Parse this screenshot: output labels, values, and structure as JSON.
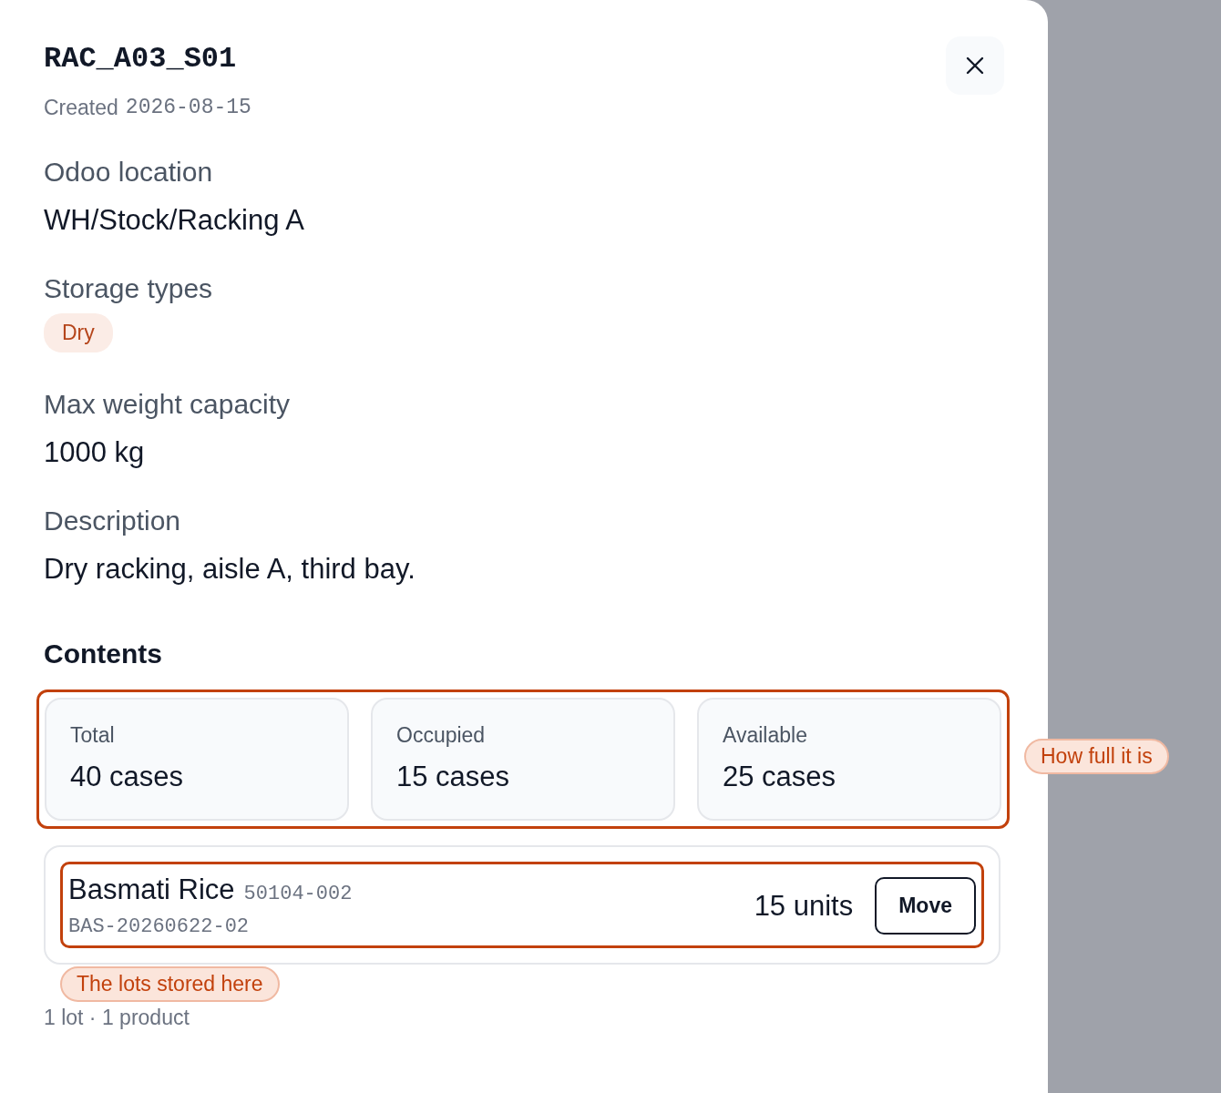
{
  "title": "RAC_A03_S01",
  "created_label": "Created",
  "created_date": "2026-08-15",
  "fields": [
    {
      "label": "Odoo location",
      "kind": "text",
      "value": "WH/Stock/Racking A"
    },
    {
      "label": "Storage types",
      "kind": "tags",
      "tags": [
        "Dry"
      ]
    },
    {
      "label": "Max weight capacity",
      "kind": "text",
      "value": "1000 kg"
    },
    {
      "label": "Description",
      "kind": "text",
      "value": "Dry racking, aisle A, third bay."
    }
  ],
  "contents": {
    "heading": "Contents",
    "stats": [
      {
        "label": "Total",
        "value": "40 cases"
      },
      {
        "label": "Occupied",
        "value": "15 cases"
      },
      {
        "label": "Available",
        "value": "25 cases"
      }
    ],
    "stats_callout": "How full it is",
    "lots": [
      {
        "name": "Basmati Rice",
        "code": "50104-002",
        "lot": "BAS-20260622-02",
        "quantity": "15 units",
        "action": "Move"
      }
    ],
    "lots_callout": "The lots stored here",
    "summary": "1 lot · 1 product"
  }
}
